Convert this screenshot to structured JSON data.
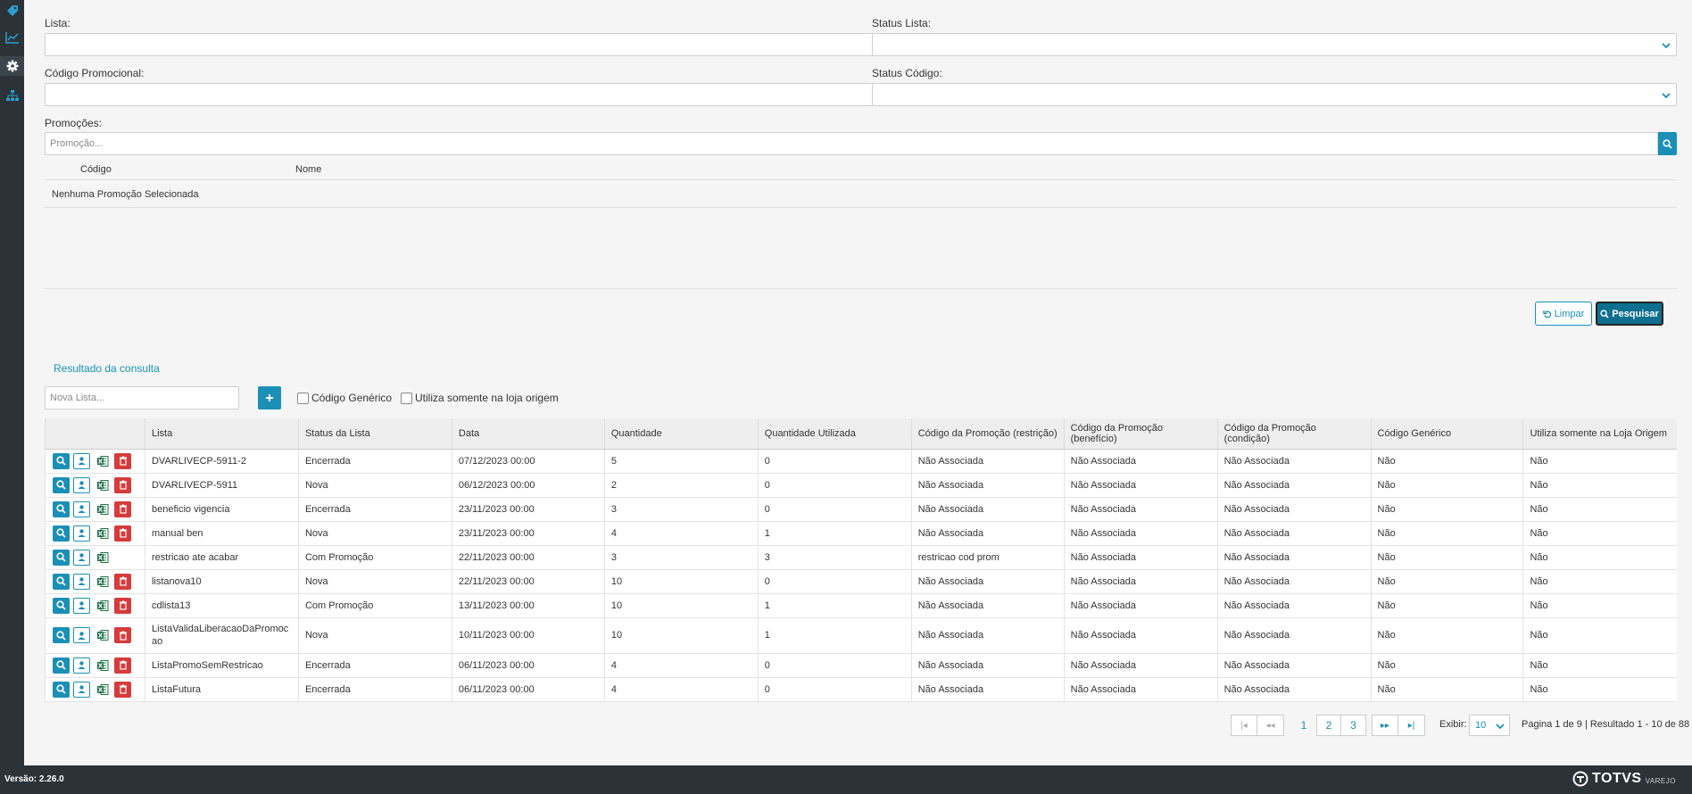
{
  "app": {
    "version_label": "Versão: 2.26.0",
    "brand": "TOTVS",
    "brand_sub": "VAREJO"
  },
  "sidebar": {
    "items": [
      {
        "icon": "tag-icon"
      },
      {
        "icon": "line-chart-icon"
      },
      {
        "icon": "gear-icon",
        "active": true
      },
      {
        "icon": "sitemap-icon"
      }
    ]
  },
  "filters": {
    "lista_label": "Lista:",
    "lista_value": "",
    "status_lista_label": "Status Lista:",
    "status_lista_value": "",
    "codigo_label": "Código Promocional:",
    "codigo_value": "",
    "status_codigo_label": "Status Código:",
    "status_codigo_value": "",
    "promocoes_label": "Promoções:",
    "promocao_placeholder": "Promoção...",
    "promo_table": {
      "col_codigo": "Código",
      "col_nome": "Nome",
      "empty_text": "Nenhuma Promoção Selecionada"
    }
  },
  "actions": {
    "limpar": "Limpar",
    "pesquisar": "Pesquisar"
  },
  "results": {
    "title": "Resultado da consulta",
    "nova_lista_placeholder": "Nova Lista...",
    "chk_generico": "Código Genérico",
    "chk_loja_origem": "Utiliza somente na loja origem",
    "columns": [
      "Lista",
      "Status da Lista",
      "Data",
      "Quantidade",
      "Quantidade Utilizada",
      "Código da Promoção (restrição)",
      "Código da Promoção (benefício)",
      "Código da Promoção (condição)",
      "Código Genérico",
      "Utiliza somente na Loja Origem"
    ],
    "rows": [
      {
        "lista": "DVARLIVECP-5911-2",
        "status": "Encerrada",
        "data": "07/12/2023 00:00",
        "qtd": "5",
        "qtd_util": "0",
        "restricao": "Não Associada",
        "beneficio": "Não Associada",
        "condicao": "Não Associada",
        "generico": "Não",
        "loja_origem": "Não",
        "deletable": true
      },
      {
        "lista": "DVARLIVECP-5911",
        "status": "Nova",
        "data": "06/12/2023 00:00",
        "qtd": "2",
        "qtd_util": "0",
        "restricao": "Não Associada",
        "beneficio": "Não Associada",
        "condicao": "Não Associada",
        "generico": "Não",
        "loja_origem": "Não",
        "deletable": true
      },
      {
        "lista": "beneficio vigencia",
        "status": "Encerrada",
        "data": "23/11/2023 00:00",
        "qtd": "3",
        "qtd_util": "0",
        "restricao": "Não Associada",
        "beneficio": "Não Associada",
        "condicao": "Não Associada",
        "generico": "Não",
        "loja_origem": "Não",
        "deletable": true
      },
      {
        "lista": "manual ben",
        "status": "Nova",
        "data": "23/11/2023 00:00",
        "qtd": "4",
        "qtd_util": "1",
        "restricao": "Não Associada",
        "beneficio": "Não Associada",
        "condicao": "Não Associada",
        "generico": "Não",
        "loja_origem": "Não",
        "deletable": true
      },
      {
        "lista": "restricao ate acabar",
        "status": "Com Promoção",
        "data": "22/11/2023 00:00",
        "qtd": "3",
        "qtd_util": "3",
        "restricao": "restricao cod prom",
        "beneficio": "Não Associada",
        "condicao": "Não Associada",
        "generico": "Não",
        "loja_origem": "Não",
        "deletable": false
      },
      {
        "lista": "listanova10",
        "status": "Nova",
        "data": "22/11/2023 00:00",
        "qtd": "10",
        "qtd_util": "0",
        "restricao": "Não Associada",
        "beneficio": "Não Associada",
        "condicao": "Não Associada",
        "generico": "Não",
        "loja_origem": "Não",
        "deletable": true
      },
      {
        "lista": "cdlista13",
        "status": "Com Promoção",
        "data": "13/11/2023 00:00",
        "qtd": "10",
        "qtd_util": "1",
        "restricao": "Não Associada",
        "beneficio": "Não Associada",
        "condicao": "Não Associada",
        "generico": "Não",
        "loja_origem": "Não",
        "deletable": true
      },
      {
        "lista": "ListaValidaLiberacaoDaPromocao",
        "status": "Nova",
        "data": "10/11/2023 00:00",
        "qtd": "10",
        "qtd_util": "1",
        "restricao": "Não Associada",
        "beneficio": "Não Associada",
        "condicao": "Não Associada",
        "generico": "Não",
        "loja_origem": "Não",
        "deletable": true
      },
      {
        "lista": "ListaPromoSemRestricao",
        "status": "Encerrada",
        "data": "06/11/2023 00:00",
        "qtd": "4",
        "qtd_util": "0",
        "restricao": "Não Associada",
        "beneficio": "Não Associada",
        "condicao": "Não Associada",
        "generico": "Não",
        "loja_origem": "Não",
        "deletable": true
      },
      {
        "lista": "ListaFutura",
        "status": "Encerrada",
        "data": "06/11/2023 00:00",
        "qtd": "4",
        "qtd_util": "0",
        "restricao": "Não Associada",
        "beneficio": "Não Associada",
        "condicao": "Não Associada",
        "generico": "Não",
        "loja_origem": "Não",
        "deletable": true
      }
    ]
  },
  "pagination": {
    "pages": [
      "1",
      "2",
      "3"
    ],
    "current_page": "1",
    "first": "|◂",
    "prev": "◂◂",
    "next": "▸▸",
    "last": "▸|",
    "exibir_label": "Exibir:",
    "exibir_value": "10",
    "info": "Pagina 1 de 9 | Resultado 1 - 10 de 88"
  },
  "colors": {
    "accent": "#1b8fb6",
    "sidebar": "#2b3338",
    "danger": "#d63b3b",
    "excel": "#1e7145"
  }
}
